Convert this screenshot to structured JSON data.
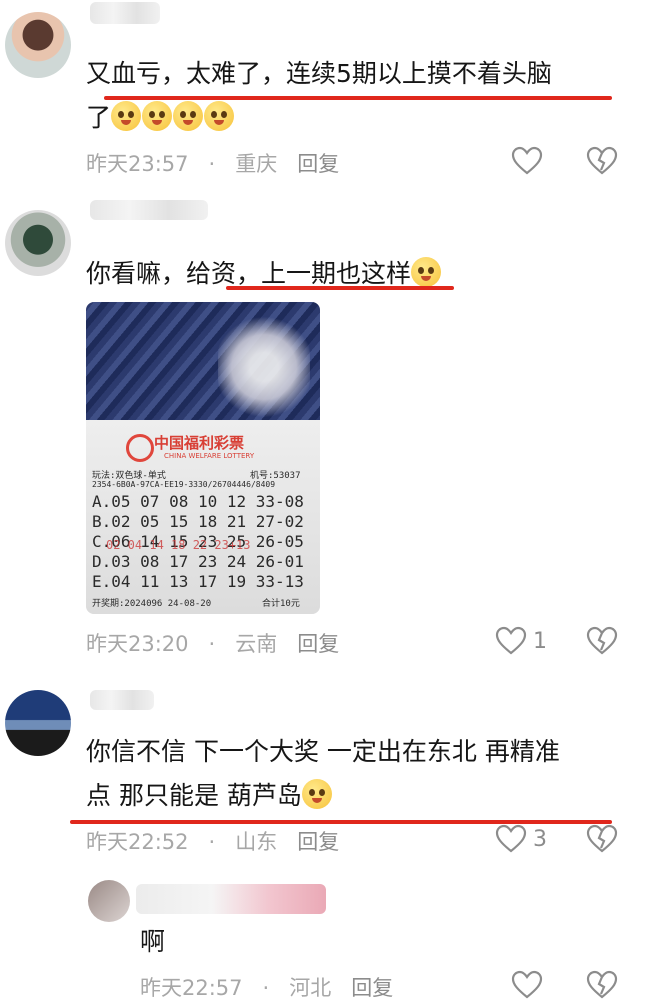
{
  "comments": [
    {
      "text_line1": "又血亏，太难了，连续5期以上摸不着头脑",
      "text_line2": "了",
      "emoji_count": 4,
      "time": "昨天23:57",
      "separator": "·",
      "location": "重庆",
      "reply": "回复",
      "likes": ""
    },
    {
      "text_line1": "你看嘛，给资，上一期也这样",
      "time": "昨天23:20",
      "separator": "·",
      "location": "云南",
      "reply": "回复",
      "likes": "1",
      "ticket": {
        "brand": "中国福利彩票",
        "brand_en": "CHINA WELFARE LOTTERY",
        "play": "玩法:双色球-单式",
        "machine": "机号:53037",
        "serial": "2354-6B0A-97CA-EE19-3330/26704446/8409",
        "rows": [
          "A.05 07 08 10 12 33-08",
          "B.02 05 15 18 21 27-02",
          "C.06 14 15 23 25 26-05",
          "D.03 08 17 23 24 26-01",
          "E.04 11 13 17 19 33-13"
        ],
        "stamp": "02 04 14 18 22 23+13",
        "issue": "开奖期:2024096 24-08-20",
        "total": "合计10元"
      }
    },
    {
      "text_line1": "你信不信 下一个大奖 一定出在东北 再精准",
      "text_line2": "点 那只能是 葫芦岛",
      "time": "昨天22:52",
      "separator": "·",
      "location": "山东",
      "reply": "回复",
      "likes": "3"
    },
    {
      "text_line1": "啊",
      "time": "昨天22:57",
      "separator": "·",
      "location": "河北",
      "reply": "回复",
      "likes": ""
    }
  ],
  "colors": {
    "highlight": "#e0271c",
    "meta": "#a7a7a7"
  },
  "icons": {
    "like": "heart-outline-icon",
    "dislike": "broken-heart-icon"
  }
}
